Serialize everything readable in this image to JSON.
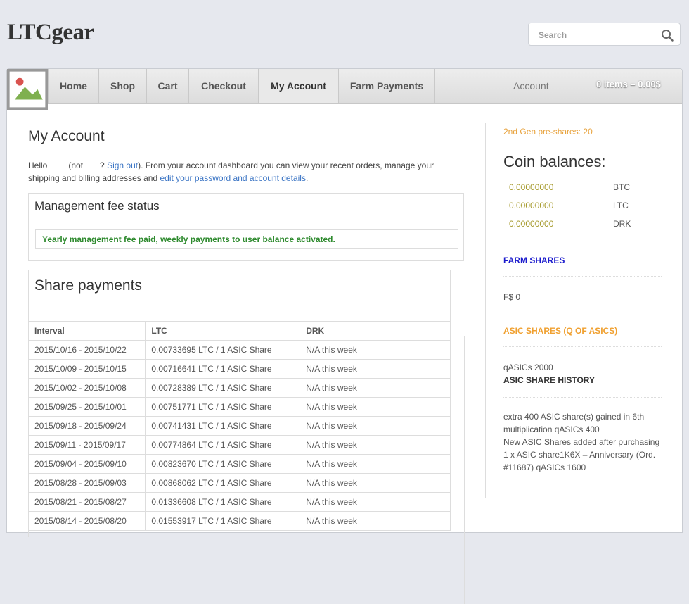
{
  "site": {
    "title": "LTCgear"
  },
  "search": {
    "placeholder": "Search"
  },
  "nav": {
    "items": [
      {
        "label": "Home"
      },
      {
        "label": "Shop"
      },
      {
        "label": "Cart"
      },
      {
        "label": "Checkout"
      },
      {
        "label": "My Account"
      },
      {
        "label": "Farm Payments"
      }
    ],
    "account_label": "Account",
    "cart_label": "0 items – 0.00$"
  },
  "page": {
    "title": "My Account",
    "intro": {
      "hello": "Hello",
      "not": "(not",
      "q": "?",
      "sign_out": "Sign out",
      "middle": "). From your account dashboard you can view your recent orders, manage your shipping and billing addresses and",
      "edit_link": "edit your password and account details",
      "end": "."
    }
  },
  "management": {
    "title": "Management fee status",
    "message": "Yearly management fee paid, weekly payments to user balance activated."
  },
  "share_payments": {
    "title": "Share payments",
    "columns": [
      "Interval",
      "LTC",
      "DRK"
    ],
    "rows": [
      [
        "2015/10/16 - 2015/10/22",
        "0.00733695 LTC / 1 ASIC Share",
        "N/A this week"
      ],
      [
        "2015/10/09 - 2015/10/15",
        "0.00716641 LTC / 1 ASIC Share",
        "N/A this week"
      ],
      [
        "2015/10/02 - 2015/10/08",
        "0.00728389 LTC / 1 ASIC Share",
        "N/A this week"
      ],
      [
        "2015/09/25 - 2015/10/01",
        "0.00751771 LTC / 1 ASIC Share",
        "N/A this week"
      ],
      [
        "2015/09/18 - 2015/09/24",
        "0.00741431 LTC / 1 ASIC Share",
        "N/A this week"
      ],
      [
        "2015/09/11 - 2015/09/17",
        "0.00774864 LTC / 1 ASIC Share",
        "N/A this week"
      ],
      [
        "2015/09/04 - 2015/09/10",
        "0.00823670 LTC / 1 ASIC Share",
        "N/A this week"
      ],
      [
        "2015/08/28 - 2015/09/03",
        "0.00868062 LTC / 1 ASIC Share",
        "N/A this week"
      ],
      [
        "2015/08/21 - 2015/08/27",
        "0.01336608 LTC / 1 ASIC Share",
        "N/A this week"
      ],
      [
        "2015/08/14 - 2015/08/20",
        "0.01553917 LTC / 1 ASIC Share",
        "N/A this week"
      ]
    ]
  },
  "sidebar": {
    "pre_shares": "2nd Gen pre-shares: 20",
    "coin_title": "Coin balances:",
    "balances": [
      {
        "amount": "0.00000000",
        "currency": "BTC"
      },
      {
        "amount": "0.00000000",
        "currency": "LTC"
      },
      {
        "amount": "0.00000000",
        "currency": "DRK"
      }
    ],
    "farm_shares_heading": "FARM SHARES",
    "farm_shares_value": "F$ 0",
    "asic_shares_heading": "ASIC SHARES (Q OF ASICS)",
    "qasics": "qASICs 2000",
    "history_heading": "ASIC SHARE HISTORY",
    "history_1": "extra 400 ASIC share(s) gained in 6th multiplication qASICs 400",
    "history_2": "New ASIC Shares added after purchasing 1 x ASIC share1K6X – Anniversary (Ord. #11687) qASICs 1600"
  },
  "colors": {
    "farm_heading": "#1a1acc",
    "asic_heading": "#f0a030",
    "success": "#2e8a2e",
    "link": "#3a74c4"
  }
}
